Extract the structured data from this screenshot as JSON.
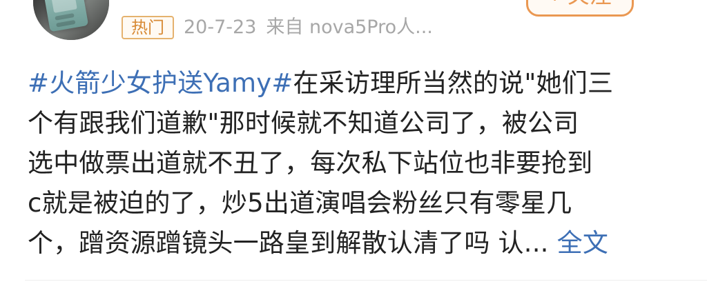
{
  "header": {
    "follow_label": "+ 关注",
    "hot_badge": "热门",
    "date": "20-7-23",
    "source": "来自 nova5Pro人..."
  },
  "post": {
    "line1_hashtag": "#火箭少女护送Yamy#",
    "line1_text": "在采访理所当然的说\"她们三",
    "line2": "个有跟我们道歉\"那时候就不知道公司了，被公司",
    "line3": "选中做票出道就不丑了，每次私下站位也非要抢到",
    "line4": "c就是被迫的了，炒5出道演唱会粉丝只有零星几",
    "line5_text": "个，蹭资源蹭镜头一路皇到解散认清了吗 认...",
    "line5_more": "全文"
  },
  "colors": {
    "link": "#3d6fb5",
    "accent": "#ea9852",
    "meta": "#a7a7a7",
    "text": "#222222"
  }
}
